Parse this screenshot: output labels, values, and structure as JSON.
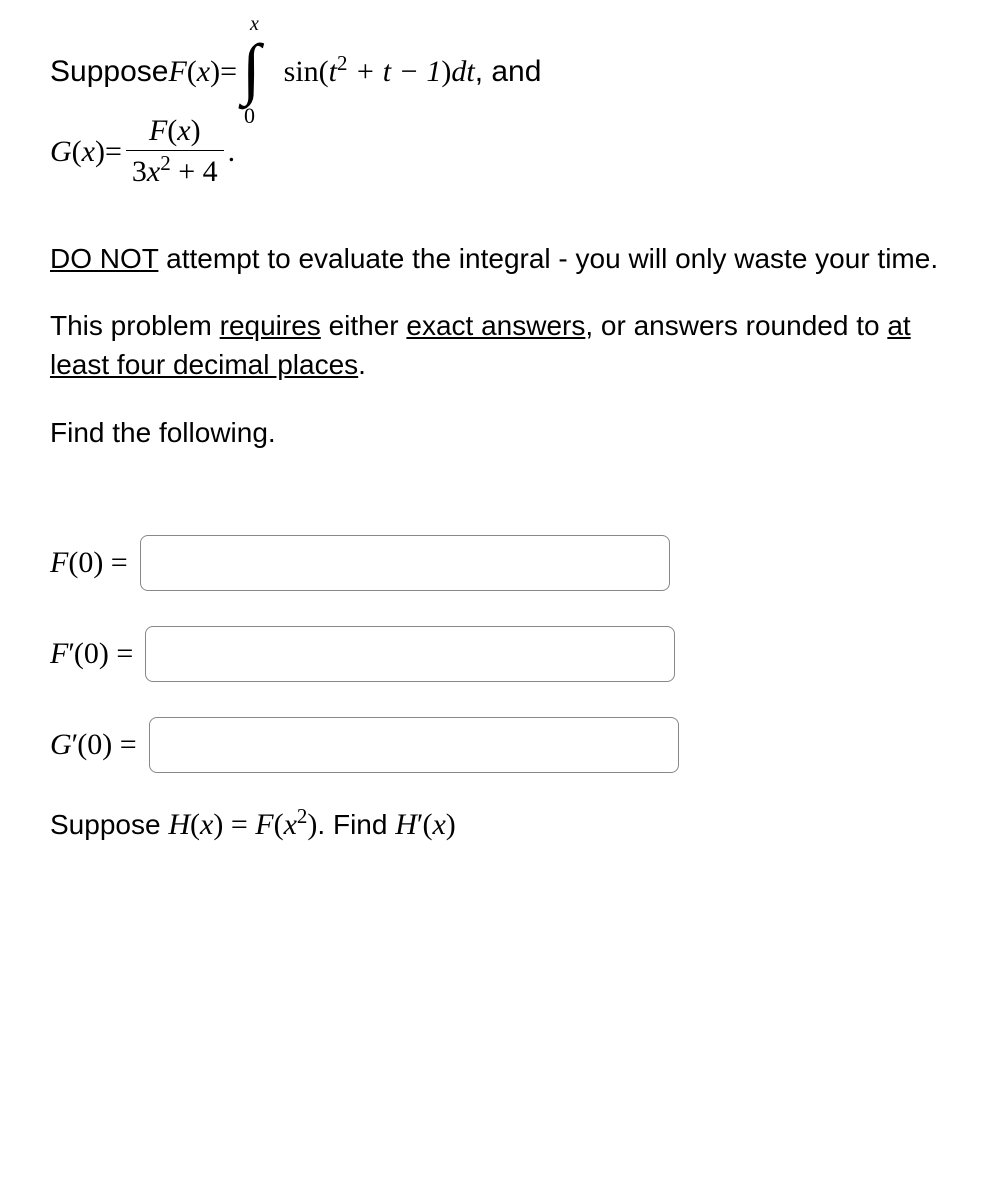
{
  "problem": {
    "suppose_text": "Suppose ",
    "F_func": "F",
    "open_paren": "(",
    "x_var": "x",
    "close_paren": ")",
    "equals": " = ",
    "integral_upper": "x",
    "integral_lower": "0",
    "integrand_sin": "sin",
    "integrand_t2": "t",
    "integrand_exp2": "2",
    "integrand_plus_t": " + t − 1",
    "integrand_dt": "dt",
    "and_text": ", and",
    "G_func": "G",
    "frac_num_F": "F",
    "frac_num_x": "x",
    "frac_den_3": "3",
    "frac_den_x": "x",
    "frac_den_exp": "2",
    "frac_den_plus4": " + 4",
    "period": "."
  },
  "instructions": {
    "line1_bold": "DO NOT",
    "line1_rest": " attempt to evaluate the integral - you will only waste your time.",
    "line2_part1": "This problem ",
    "line2_requires": "requires",
    "line2_part2": " either ",
    "line2_exact": "exact answers",
    "line2_part3": ", or answers rounded to ",
    "line2_decimal": "at least four decimal places",
    "line2_part4": ".",
    "find_text": "Find the following."
  },
  "answers": {
    "f0_label_F": "F",
    "f0_label_arg": "(0) = ",
    "fprime0_label_F": "F",
    "fprime0_prime": "′",
    "fprime0_arg": "(0) = ",
    "gprime0_label_G": "G",
    "gprime0_prime": "′",
    "gprime0_arg": "(0) = "
  },
  "final": {
    "suppose": "Suppose ",
    "H": "H",
    "open": "(",
    "x": "x",
    "close": ")",
    "eq": " = ",
    "F": "F",
    "xopen": "(",
    "x2_x": "x",
    "x2_exp": "2",
    "xclose": ")",
    "period": ". ",
    "find": "Find ",
    "Hprime_H": "H",
    "Hprime_prime": "′",
    "Hprime_open": "(",
    "Hprime_x": "x",
    "Hprime_close": ")"
  }
}
